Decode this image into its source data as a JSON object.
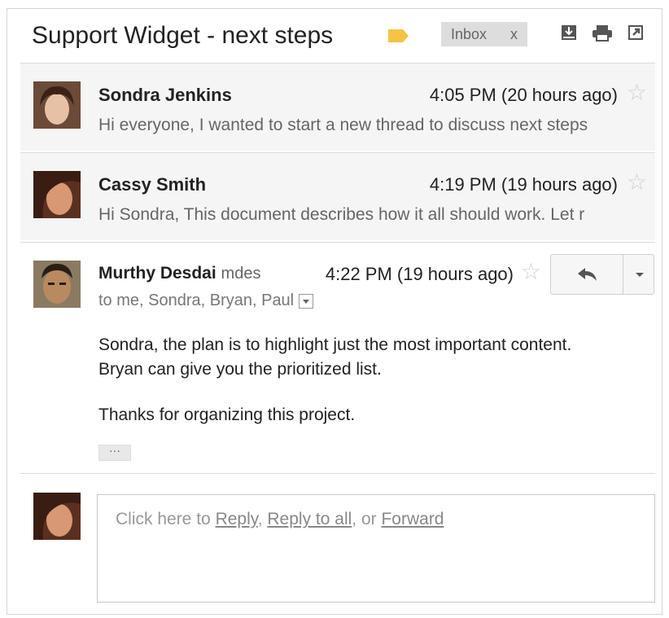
{
  "thread": {
    "subject": "Support Widget - next steps",
    "label_color": "#f6c343",
    "inbox_chip": {
      "label": "Inbox",
      "remove": "x"
    },
    "toolbar_icons": [
      "download-icon",
      "print-icon",
      "new-window-icon"
    ]
  },
  "messages": [
    {
      "sender": "Sondra Jenkins",
      "time": "4:05 PM (20 hours ago)",
      "snippet": "Hi everyone, I wanted to start a new thread to discuss next steps"
    },
    {
      "sender": "Cassy Smith",
      "time": "4:19 PM (19 hours ago)",
      "snippet": "Hi Sondra, This document describes how it all should work. Let r"
    }
  ],
  "expanded": {
    "sender": "Murthy Desdai",
    "alias": "mdes",
    "time": "4:22 PM (19 hours ago)",
    "to": "to me, Sondra, Bryan, Paul",
    "body": [
      "Sondra, the plan is to highlight just the most important content.",
      "Bryan can give you the prioritized list.",
      "Thanks for organizing this project."
    ],
    "trimmed": "···"
  },
  "reply": {
    "prefix": "Click here to",
    "reply": "Reply",
    "sep1": ",",
    "reply_all": "Reply to all",
    "sep2": ", or",
    "forward": "Forward"
  },
  "colors": {
    "collapsed_bg": "#f5f5f5",
    "star": "#cfcfcf"
  }
}
